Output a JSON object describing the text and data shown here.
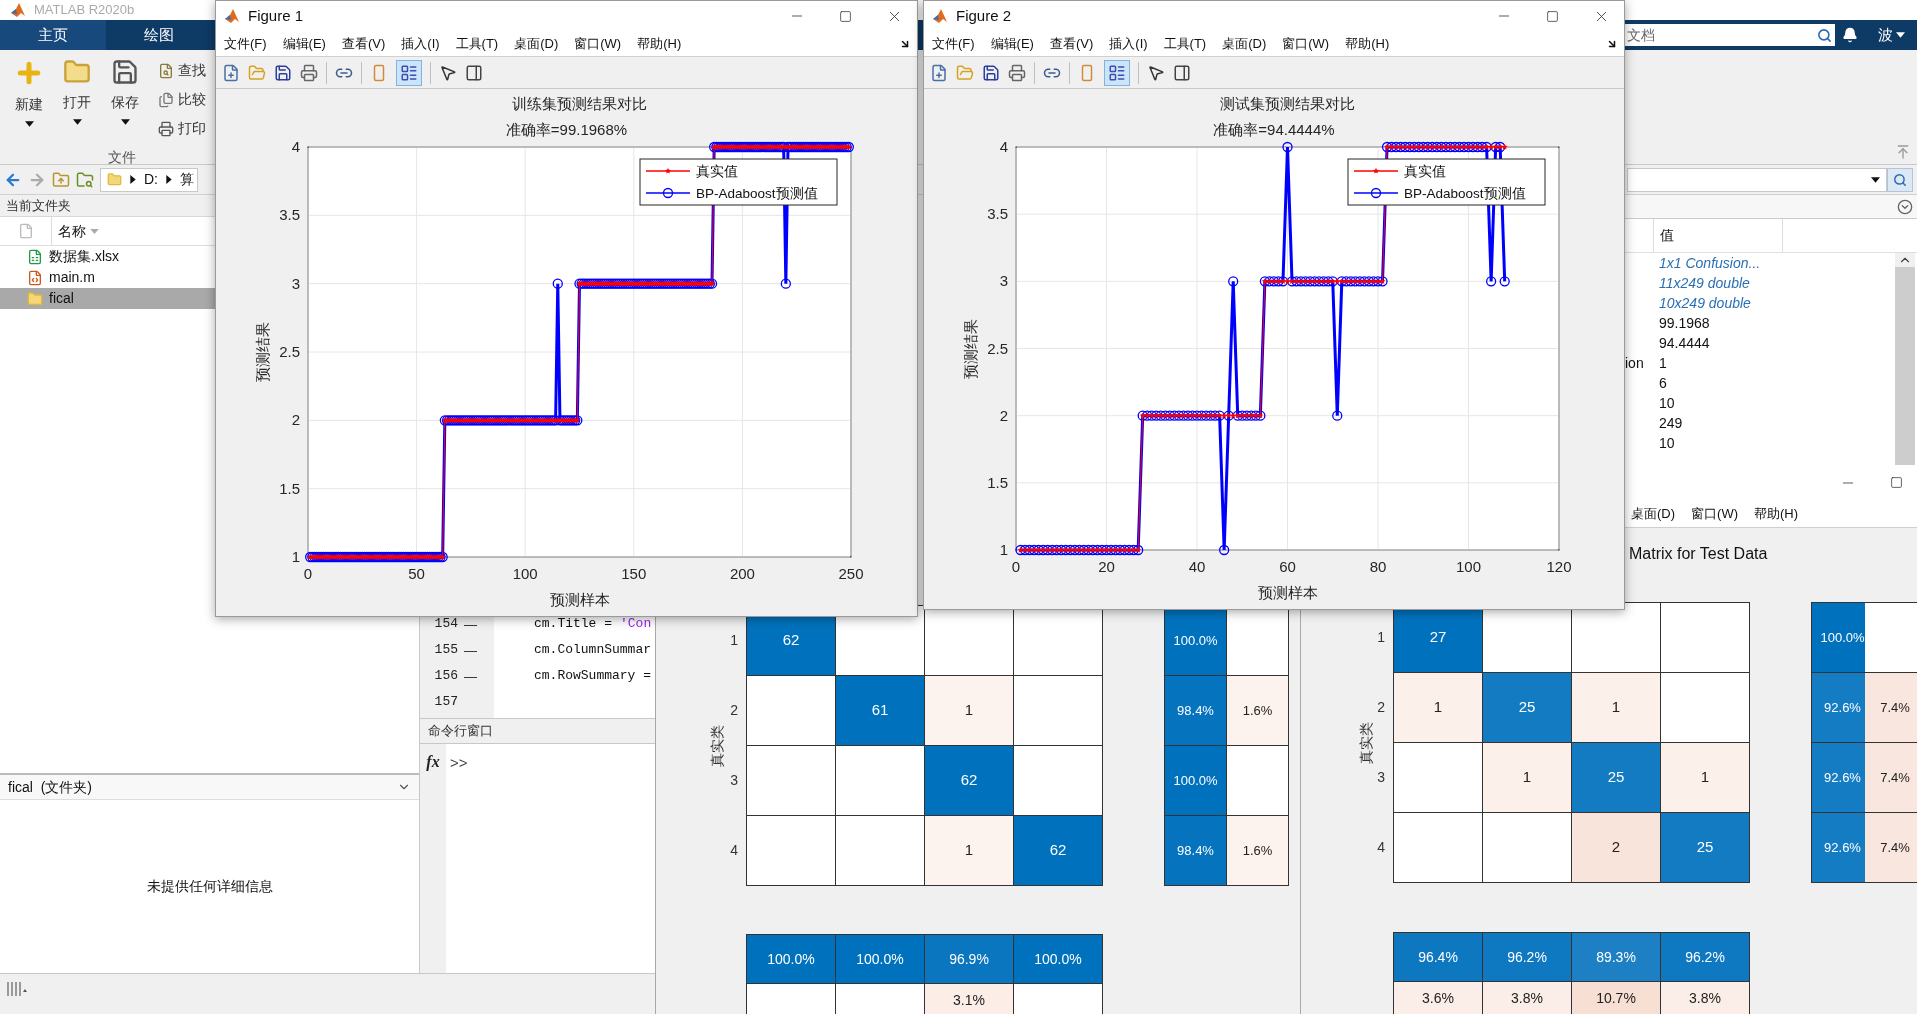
{
  "main": {
    "title": "MATLAB R2020b",
    "tabs": [
      {
        "label": "主页",
        "selected": true
      },
      {
        "label": "绘图",
        "selected": false
      }
    ],
    "search": {
      "placeholder": "文档"
    },
    "user": "波",
    "ribbon": {
      "large_buttons": [
        "新建",
        "打开",
        "保存"
      ],
      "small_buttons": [
        "查找",
        "比较",
        "打印"
      ],
      "section": "文件"
    },
    "path": [
      "D:",
      "算"
    ],
    "current_folder": {
      "title": "当前文件夹",
      "column": "名称",
      "files": [
        {
          "name": "数据集.xlsx",
          "kind": "spreadsheet",
          "selected": false
        },
        {
          "name": "main.m",
          "kind": "script",
          "selected": false
        },
        {
          "name": "fical",
          "kind": "folder",
          "selected": true
        }
      ]
    },
    "details": {
      "title": "fical  (文件夹)",
      "message": "未提供任何详细信息"
    },
    "editor": {
      "lines": [
        {
          "number": "154",
          "marker": "—",
          "code": "cm.Title =",
          "string": "'Con"
        },
        {
          "number": "155",
          "marker": "—",
          "code": "cm.ColumnSummar"
        },
        {
          "number": "156",
          "marker": "—",
          "code": "cm.RowSummary ="
        },
        {
          "number": "157"
        }
      ]
    },
    "command_window": {
      "title": "命令行窗口",
      "function_button": "fx",
      "prompt": ">>"
    },
    "workspace": {
      "column": "值",
      "rows": [
        {
          "value": "1x1 Confusion...",
          "kind": "link"
        },
        {
          "value": "11x249 double",
          "kind": "link"
        },
        {
          "value": "10x249 double",
          "kind": "link"
        },
        {
          "value": "99.1968",
          "kind": "plain"
        },
        {
          "value": "94.4444",
          "kind": "plain"
        },
        {
          "name": "ion",
          "value": "1",
          "kind": "plain"
        },
        {
          "value": "6",
          "kind": "plain"
        },
        {
          "value": "10",
          "kind": "plain"
        },
        {
          "value": "249",
          "kind": "plain"
        },
        {
          "value": "10",
          "kind": "plain"
        }
      ]
    }
  },
  "figures": [
    {
      "title": "Figure 1",
      "menu": [
        "文件(F)",
        "编辑(E)",
        "查看(V)",
        "插入(I)",
        "工具(T)",
        "桌面(D)",
        "窗口(W)",
        "帮助(H)"
      ],
      "legend_button_on": true,
      "subtitle": "准确率=99.1968%",
      "chart_data": {
        "type": "line",
        "title": "训练集预测结果对比",
        "xlabel": "预测样本",
        "ylabel": "预测结果",
        "xlim": [
          0,
          250
        ],
        "ylim": [
          1,
          4
        ],
        "xticks": [
          0,
          50,
          100,
          150,
          200,
          250
        ],
        "yticks": [
          1,
          1.5,
          2,
          2.5,
          3,
          3.5,
          4
        ],
        "grid": true,
        "legend": true,
        "x": [
          1,
          2,
          3,
          4,
          5,
          6,
          7,
          8,
          9,
          10,
          11,
          12,
          13,
          14,
          15,
          16,
          17,
          18,
          19,
          20,
          21,
          22,
          23,
          24,
          25,
          26,
          27,
          28,
          29,
          30,
          31,
          32,
          33,
          34,
          35,
          36,
          37,
          38,
          39,
          40,
          41,
          42,
          43,
          44,
          45,
          46,
          47,
          48,
          49,
          50,
          51,
          52,
          53,
          54,
          55,
          56,
          57,
          58,
          59,
          60,
          61,
          62,
          63,
          64,
          65,
          66,
          67,
          68,
          69,
          70,
          71,
          72,
          73,
          74,
          75,
          76,
          77,
          78,
          79,
          80,
          81,
          82,
          83,
          84,
          85,
          86,
          87,
          88,
          89,
          90,
          91,
          92,
          93,
          94,
          95,
          96,
          97,
          98,
          99,
          100,
          101,
          102,
          103,
          104,
          105,
          106,
          107,
          108,
          109,
          110,
          111,
          112,
          113,
          114,
          115,
          116,
          117,
          118,
          119,
          120,
          121,
          122,
          123,
          124,
          125,
          126,
          127,
          128,
          129,
          130,
          131,
          132,
          133,
          134,
          135,
          136,
          137,
          138,
          139,
          140,
          141,
          142,
          143,
          144,
          145,
          146,
          147,
          148,
          149,
          150,
          151,
          152,
          153,
          154,
          155,
          156,
          157,
          158,
          159,
          160,
          161,
          162,
          163,
          164,
          165,
          166,
          167,
          168,
          169,
          170,
          171,
          172,
          173,
          174,
          175,
          176,
          177,
          178,
          179,
          180,
          181,
          182,
          183,
          184,
          185,
          186,
          187,
          188,
          189,
          190,
          191,
          192,
          193,
          194,
          195,
          196,
          197,
          198,
          199,
          200,
          201,
          202,
          203,
          204,
          205,
          206,
          207,
          208,
          209,
          210,
          211,
          212,
          213,
          214,
          215,
          216,
          217,
          218,
          219,
          220,
          221,
          222,
          223,
          224,
          225,
          226,
          227,
          228,
          229,
          230,
          231,
          232,
          233,
          234,
          235,
          236,
          237,
          238,
          239,
          240,
          241,
          242,
          243,
          244,
          245,
          246,
          247,
          248,
          249
        ],
        "series": [
          {
            "name": "真实值",
            "color": "#ff0000",
            "marker": "star",
            "values": [
              1,
              1,
              1,
              1,
              1,
              1,
              1,
              1,
              1,
              1,
              1,
              1,
              1,
              1,
              1,
              1,
              1,
              1,
              1,
              1,
              1,
              1,
              1,
              1,
              1,
              1,
              1,
              1,
              1,
              1,
              1,
              1,
              1,
              1,
              1,
              1,
              1,
              1,
              1,
              1,
              1,
              1,
              1,
              1,
              1,
              1,
              1,
              1,
              1,
              1,
              1,
              1,
              1,
              1,
              1,
              1,
              1,
              1,
              1,
              1,
              1,
              1,
              2,
              2,
              2,
              2,
              2,
              2,
              2,
              2,
              2,
              2,
              2,
              2,
              2,
              2,
              2,
              2,
              2,
              2,
              2,
              2,
              2,
              2,
              2,
              2,
              2,
              2,
              2,
              2,
              2,
              2,
              2,
              2,
              2,
              2,
              2,
              2,
              2,
              2,
              2,
              2,
              2,
              2,
              2,
              2,
              2,
              2,
              2,
              2,
              2,
              2,
              2,
              2,
              2,
              2,
              2,
              2,
              2,
              2,
              2,
              2,
              2,
              2,
              3,
              3,
              3,
              3,
              3,
              3,
              3,
              3,
              3,
              3,
              3,
              3,
              3,
              3,
              3,
              3,
              3,
              3,
              3,
              3,
              3,
              3,
              3,
              3,
              3,
              3,
              3,
              3,
              3,
              3,
              3,
              3,
              3,
              3,
              3,
              3,
              3,
              3,
              3,
              3,
              3,
              3,
              3,
              3,
              3,
              3,
              3,
              3,
              3,
              3,
              3,
              3,
              3,
              3,
              3,
              3,
              3,
              3,
              3,
              3,
              3,
              3,
              4,
              4,
              4,
              4,
              4,
              4,
              4,
              4,
              4,
              4,
              4,
              4,
              4,
              4,
              4,
              4,
              4,
              4,
              4,
              4,
              4,
              4,
              4,
              4,
              4,
              4,
              4,
              4,
              4,
              4,
              4,
              4,
              4,
              4,
              4,
              4,
              4,
              4,
              4,
              4,
              4,
              4,
              4,
              4,
              4,
              4,
              4,
              4,
              4,
              4,
              4,
              4,
              4,
              4,
              4,
              4,
              4,
              4,
              4,
              4,
              4,
              4,
              4
            ]
          },
          {
            "name": "BP-Adaboost预测值",
            "color": "#0000ff",
            "marker": "circle",
            "values": [
              1,
              1,
              1,
              1,
              1,
              1,
              1,
              1,
              1,
              1,
              1,
              1,
              1,
              1,
              1,
              1,
              1,
              1,
              1,
              1,
              1,
              1,
              1,
              1,
              1,
              1,
              1,
              1,
              1,
              1,
              1,
              1,
              1,
              1,
              1,
              1,
              1,
              1,
              1,
              1,
              1,
              1,
              1,
              1,
              1,
              1,
              1,
              1,
              1,
              1,
              1,
              1,
              1,
              1,
              1,
              1,
              1,
              1,
              1,
              1,
              1,
              1,
              2,
              2,
              2,
              2,
              2,
              2,
              2,
              2,
              2,
              2,
              2,
              2,
              2,
              2,
              2,
              2,
              2,
              2,
              2,
              2,
              2,
              2,
              2,
              2,
              2,
              2,
              2,
              2,
              2,
              2,
              2,
              2,
              2,
              2,
              2,
              2,
              2,
              2,
              2,
              2,
              2,
              2,
              2,
              2,
              2,
              2,
              2,
              2,
              2,
              2,
              2,
              2,
              3,
              2,
              2,
              2,
              2,
              2,
              2,
              2,
              2,
              2,
              3,
              3,
              3,
              3,
              3,
              3,
              3,
              3,
              3,
              3,
              3,
              3,
              3,
              3,
              3,
              3,
              3,
              3,
              3,
              3,
              3,
              3,
              3,
              3,
              3,
              3,
              3,
              3,
              3,
              3,
              3,
              3,
              3,
              3,
              3,
              3,
              3,
              3,
              3,
              3,
              3,
              3,
              3,
              3,
              3,
              3,
              3,
              3,
              3,
              3,
              3,
              3,
              3,
              3,
              3,
              3,
              3,
              3,
              3,
              3,
              3,
              3,
              4,
              4,
              4,
              4,
              4,
              4,
              4,
              4,
              4,
              4,
              4,
              4,
              4,
              4,
              4,
              4,
              4,
              4,
              4,
              4,
              4,
              4,
              4,
              4,
              4,
              4,
              4,
              4,
              4,
              4,
              4,
              4,
              4,
              3,
              4,
              4,
              4,
              4,
              4,
              4,
              4,
              4,
              4,
              4,
              4,
              4,
              4,
              4,
              4,
              4,
              4,
              4,
              4,
              4,
              4,
              4,
              4,
              4,
              4,
              4,
              4,
              4,
              4
            ]
          }
        ]
      }
    },
    {
      "title": "Figure 2",
      "menu": [
        "文件(F)",
        "编辑(E)",
        "查看(V)",
        "插入(I)",
        "工具(T)",
        "桌面(D)",
        "窗口(W)",
        "帮助(H)"
      ],
      "legend_button_on": true,
      "subtitle": "准确率=94.4444%",
      "chart_data": {
        "type": "line",
        "title": "测试集预测结果对比",
        "xlabel": "预测样本",
        "ylabel": "预测结果",
        "xlim": [
          0,
          120
        ],
        "ylim": [
          1,
          4
        ],
        "xticks": [
          0,
          20,
          40,
          60,
          80,
          100,
          120
        ],
        "yticks": [
          1,
          1.5,
          2,
          2.5,
          3,
          3.5,
          4
        ],
        "grid": true,
        "legend": true,
        "x": [
          1,
          2,
          3,
          4,
          5,
          6,
          7,
          8,
          9,
          10,
          11,
          12,
          13,
          14,
          15,
          16,
          17,
          18,
          19,
          20,
          21,
          22,
          23,
          24,
          25,
          26,
          27,
          28,
          29,
          30,
          31,
          32,
          33,
          34,
          35,
          36,
          37,
          38,
          39,
          40,
          41,
          42,
          43,
          44,
          45,
          46,
          47,
          48,
          49,
          50,
          51,
          52,
          53,
          54,
          55,
          56,
          57,
          58,
          59,
          60,
          61,
          62,
          63,
          64,
          65,
          66,
          67,
          68,
          69,
          70,
          71,
          72,
          73,
          74,
          75,
          76,
          77,
          78,
          79,
          80,
          81,
          82,
          83,
          84,
          85,
          86,
          87,
          88,
          89,
          90,
          91,
          92,
          93,
          94,
          95,
          96,
          97,
          98,
          99,
          100,
          101,
          102,
          103,
          104,
          105,
          106,
          107,
          108
        ],
        "series": [
          {
            "name": "真实值",
            "color": "#ff0000",
            "marker": "star",
            "values": [
              1,
              1,
              1,
              1,
              1,
              1,
              1,
              1,
              1,
              1,
              1,
              1,
              1,
              1,
              1,
              1,
              1,
              1,
              1,
              1,
              1,
              1,
              1,
              1,
              1,
              1,
              1,
              2,
              2,
              2,
              2,
              2,
              2,
              2,
              2,
              2,
              2,
              2,
              2,
              2,
              2,
              2,
              2,
              2,
              2,
              2,
              2,
              2,
              2,
              2,
              2,
              2,
              2,
              2,
              3,
              3,
              3,
              3,
              3,
              3,
              3,
              3,
              3,
              3,
              3,
              3,
              3,
              3,
              3,
              3,
              3,
              3,
              3,
              3,
              3,
              3,
              3,
              3,
              3,
              3,
              3,
              4,
              4,
              4,
              4,
              4,
              4,
              4,
              4,
              4,
              4,
              4,
              4,
              4,
              4,
              4,
              4,
              4,
              4,
              4,
              4,
              4,
              4,
              4,
              4,
              4,
              4,
              4
            ]
          },
          {
            "name": "BP-Adaboost预测值",
            "color": "#0000ff",
            "marker": "circle",
            "values": [
              1,
              1,
              1,
              1,
              1,
              1,
              1,
              1,
              1,
              1,
              1,
              1,
              1,
              1,
              1,
              1,
              1,
              1,
              1,
              1,
              1,
              1,
              1,
              1,
              1,
              1,
              1,
              2,
              2,
              2,
              2,
              2,
              2,
              2,
              2,
              2,
              2,
              2,
              2,
              2,
              2,
              2,
              2,
              2,
              2,
              1,
              2,
              3,
              2,
              2,
              2,
              2,
              2,
              2,
              3,
              3,
              3,
              3,
              3,
              4,
              3,
              3,
              3,
              3,
              3,
              3,
              3,
              3,
              3,
              3,
              2,
              3,
              3,
              3,
              3,
              3,
              3,
              3,
              3,
              3,
              3,
              4,
              4,
              4,
              4,
              4,
              4,
              4,
              4,
              4,
              4,
              4,
              4,
              4,
              4,
              4,
              4,
              4,
              4,
              4,
              4,
              4,
              4,
              4,
              3,
              4,
              4,
              3
            ]
          }
        ]
      }
    }
  ],
  "confusion": [
    {
      "ylabel": "真实类",
      "row_labels": [
        "1",
        "2",
        "3",
        "4"
      ],
      "cells": [
        [
          {
            "text": "62",
            "color": "#0072bd"
          },
          {
            "color": "#ffffff"
          },
          {
            "color": "#ffffff"
          },
          {
            "color": "#ffffff"
          }
        ],
        [
          {
            "color": "#ffffff"
          },
          {
            "text": "61",
            "color": "#0072bd"
          },
          {
            "text": "1",
            "color": "#fdf3ee"
          },
          {
            "color": "#ffffff"
          }
        ],
        [
          {
            "color": "#ffffff"
          },
          {
            "color": "#ffffff"
          },
          {
            "text": "62",
            "color": "#0072bd"
          },
          {
            "color": "#ffffff"
          }
        ],
        [
          {
            "color": "#ffffff"
          },
          {
            "color": "#ffffff"
          },
          {
            "text": "1",
            "color": "#fdf3ee"
          },
          {
            "text": "62",
            "color": "#0072bd"
          }
        ]
      ],
      "row_summary": [
        [
          {
            "text": "100.0%",
            "color": "#0072bd"
          },
          {
            "color": "#ffffff"
          }
        ],
        [
          {
            "text": "98.4%",
            "color": "#0573bd"
          },
          {
            "text": "1.6%",
            "color": "#fdf3ee"
          }
        ],
        [
          {
            "text": "100.0%",
            "color": "#0072bd"
          },
          {
            "color": "#ffffff"
          }
        ],
        [
          {
            "text": "98.4%",
            "color": "#0573bd"
          },
          {
            "text": "1.6%",
            "color": "#fdf3ee"
          }
        ]
      ],
      "column_summary": [
        [
          {
            "text": "100.0%",
            "color": "#0072bd"
          },
          {
            "text": "100.0%",
            "color": "#0072bd"
          },
          {
            "text": "96.9%",
            "color": "#0a76bf"
          },
          {
            "text": "100.0%",
            "color": "#0072bd"
          }
        ],
        [
          {
            "color": "#ffffff"
          },
          {
            "color": "#ffffff"
          },
          {
            "text": "3.1%",
            "color": "#fcede6"
          },
          {
            "color": "#ffffff"
          }
        ]
      ]
    },
    {
      "title": "Matrix for Test Data",
      "menu": [
        "桌面(D)",
        "窗口(W)",
        "帮助(H)"
      ],
      "ylabel": "真实类",
      "row_labels": [
        "1",
        "2",
        "3",
        "4"
      ],
      "cells": [
        [
          {
            "text": "27",
            "color": "#0072bd"
          },
          {
            "color": "#ffffff"
          },
          {
            "color": "#ffffff"
          },
          {
            "color": "#ffffff"
          }
        ],
        [
          {
            "text": "1",
            "color": "#fbf0ea"
          },
          {
            "text": "25",
            "color": "#137bc2"
          },
          {
            "text": "1",
            "color": "#fbf0ea"
          },
          {
            "color": "#ffffff"
          }
        ],
        [
          {
            "color": "#ffffff"
          },
          {
            "text": "1",
            "color": "#fbf0ea"
          },
          {
            "text": "25",
            "color": "#137bc2"
          },
          {
            "text": "1",
            "color": "#fbf0ea"
          }
        ],
        [
          {
            "color": "#ffffff"
          },
          {
            "color": "#ffffff"
          },
          {
            "text": "2",
            "color": "#f9e4db"
          },
          {
            "text": "25",
            "color": "#137bc2"
          }
        ]
      ],
      "row_summary": [
        [
          {
            "text": "100.0%",
            "color": "#0072bd"
          },
          {
            "color": "#ffffff"
          }
        ],
        [
          {
            "text": "92.6%",
            "color": "#147cc2"
          },
          {
            "text": "7.4%",
            "color": "#f9e7df"
          }
        ],
        [
          {
            "text": "92.6%",
            "color": "#147cc2"
          },
          {
            "text": "7.4%",
            "color": "#f9e7df"
          }
        ],
        [
          {
            "text": "92.6%",
            "color": "#147cc2"
          },
          {
            "text": "7.4%",
            "color": "#f9e7df"
          }
        ]
      ],
      "column_summary": [
        [
          {
            "text": "96.4%",
            "color": "#0d78c0"
          },
          {
            "text": "96.2%",
            "color": "#0e78c0"
          },
          {
            "text": "89.3%",
            "color": "#1d7fc4"
          },
          {
            "text": "96.2%",
            "color": "#0e78c0"
          }
        ],
        [
          {
            "text": "3.6%",
            "color": "#fbeee8"
          },
          {
            "text": "3.8%",
            "color": "#fbeee8"
          },
          {
            "text": "10.7%",
            "color": "#f7dfd4"
          },
          {
            "text": "3.8%",
            "color": "#fbeee8"
          }
        ]
      ]
    }
  ]
}
